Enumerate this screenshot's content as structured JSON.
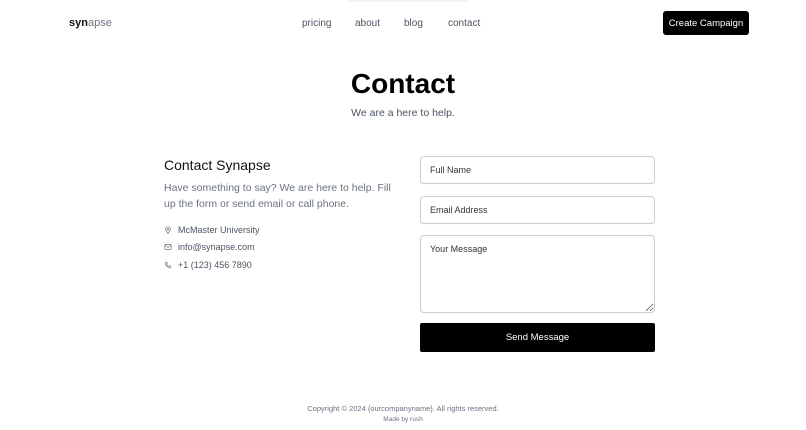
{
  "nav": {
    "logo_bold": "syn",
    "logo_light": "apse",
    "links": [
      "pricing",
      "about",
      "blog",
      "contact"
    ],
    "cta_label": "Create Campaign"
  },
  "hero": {
    "title": "Contact",
    "subtitle": "We are a here to help."
  },
  "info": {
    "title": "Contact Synapse",
    "text": "Have something to say? We are here to help. Fill up the form or send email or call phone.",
    "location": "McMaster University",
    "email": "info@synapse.com",
    "phone": "+1 (123) 456 7890",
    "icons": [
      "location-pin-icon",
      "mail-icon",
      "phone-icon"
    ]
  },
  "form": {
    "name_placeholder": "Full Name",
    "email_placeholder": "Email Address",
    "message_placeholder": "Your Message",
    "submit_label": "Send Message"
  },
  "footer": {
    "copyright": "Copyright © 2024 {ourcompanyname}. All rights reserved.",
    "made_by": "Made by rush"
  },
  "colors": {
    "accent": "#000000",
    "muted_text": "#6b7280",
    "border": "#c9ccd1"
  }
}
